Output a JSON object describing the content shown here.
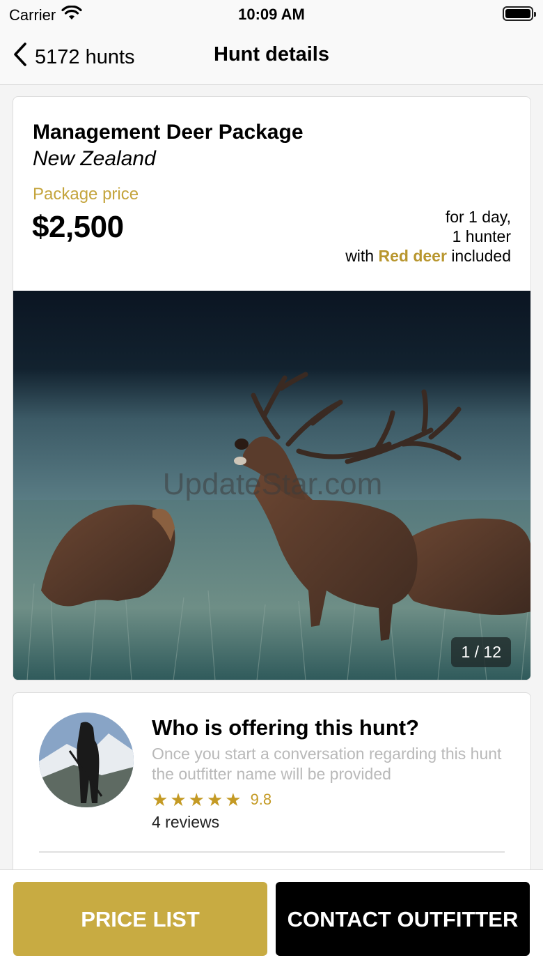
{
  "status_bar": {
    "carrier": "Carrier",
    "time": "10:09 AM"
  },
  "nav": {
    "back_label": "5172 hunts",
    "title": "Hunt details"
  },
  "package": {
    "title": "Management Deer Package",
    "location": "New Zealand",
    "price_label": "Package price",
    "price": "$2,500",
    "terms_line1": "for 1 day,",
    "terms_line2": "1 hunter",
    "terms_with": "with",
    "terms_species": "Red deer",
    "terms_included": "included",
    "photo_counter": "1 / 12",
    "watermark": "UpdateStar.com"
  },
  "outfitter": {
    "title": "Who is offering this hunt?",
    "description": "Once you start a conversation regarding this hunt the outfitter name will be provided",
    "rating_stars": 5,
    "rating_score": "9.8",
    "reviews": "4 reviews"
  },
  "actions": {
    "price_list": "PRICE LIST",
    "contact_outfitter": "CONTACT OUTFITTER"
  },
  "colors": {
    "accent_gold": "#c8ab42",
    "star_gold": "#c49a24",
    "contact_button": "#000000"
  },
  "icons": {
    "back": "chevron-left-icon",
    "wifi": "wifi-icon",
    "battery": "battery-icon",
    "star": "star-icon"
  }
}
